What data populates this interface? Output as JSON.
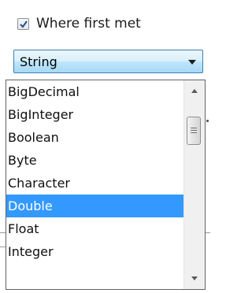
{
  "checkbox": {
    "label": "Where first met",
    "checked": true
  },
  "combo": {
    "selected_value": "String"
  },
  "dropdown": {
    "items": [
      {
        "label": "BigDecimal"
      },
      {
        "label": "BigInteger"
      },
      {
        "label": "Boolean"
      },
      {
        "label": "Byte"
      },
      {
        "label": "Character"
      },
      {
        "label": "Double"
      },
      {
        "label": "Float"
      },
      {
        "label": "Integer"
      }
    ],
    "highlighted_item": "Double"
  },
  "colors": {
    "highlight": "#3399ff",
    "combo_border": "#3c7fb1",
    "check_mark": "#2a4b8d"
  },
  "icons": {
    "checkbox": "checkmark-icon",
    "combo_arrow": "chevron-down-icon",
    "scroll_up": "scroll-up-arrow-icon",
    "scroll_down": "scroll-down-arrow-icon",
    "thumb_grip": "grip-icon"
  }
}
